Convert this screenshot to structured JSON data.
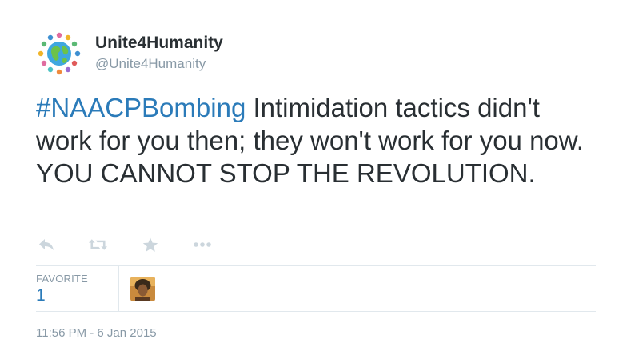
{
  "user": {
    "display_name": "Unite4Humanity",
    "handle": "@Unite4Humanity"
  },
  "tweet": {
    "hashtag": "#NAACPBombing",
    "text": " Intimidation tactics didn't work for you then; they won't work for you now. YOU CANNOT STOP THE REVOLUTION."
  },
  "actions": {
    "icons": [
      "reply-icon",
      "retweet-icon",
      "favorite-icon",
      "more-icon"
    ]
  },
  "stats": {
    "favorite_label": "FAVORITE",
    "favorite_count": "1"
  },
  "timestamp": "11:56 PM - 6 Jan 2015",
  "colors": {
    "link": "#2b7bb9",
    "muted": "#8899a6",
    "text": "#292f33",
    "divider": "#e1e8ed",
    "action_icon": "#ccd6dd"
  }
}
